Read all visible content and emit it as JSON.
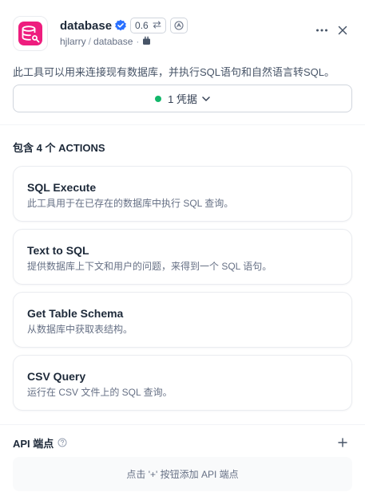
{
  "header": {
    "app_name": "database",
    "version": "0.6",
    "version_prefix": "0.",
    "author": "hjlarry",
    "path_sep": "/",
    "repo": "database",
    "meta_dot": "·"
  },
  "description": "此工具可以用来连接现有数据库，并执行SQL语句和自然语言转SQL。",
  "credentials": {
    "label": "1 凭据"
  },
  "actions_section": {
    "title": "包含 4 个 ACTIONS",
    "items": [
      {
        "name": "SQL Execute",
        "desc": "此工具用于在已存在的数据库中执行 SQL 查询。"
      },
      {
        "name": "Text to SQL",
        "desc": "提供数据库上下文和用户的问题，来得到一个 SQL 语句。"
      },
      {
        "name": "Get Table Schema",
        "desc": "从数据库中获取表结构。"
      },
      {
        "name": "CSV Query",
        "desc": "运行在 CSV 文件上的 SQL 查询。"
      }
    ]
  },
  "api_section": {
    "title": "API 端点",
    "empty_text": "点击 '+' 按钮添加 API 端点"
  },
  "colors": {
    "brand": "#ee1d7e",
    "verified": "#2970ff",
    "status_ok": "#12b76a"
  },
  "icons": {
    "logo": "database-icon",
    "verified": "verified-badge-icon",
    "swap": "swap-icon",
    "plugin": "plugin-icon",
    "more": "more-dots-icon",
    "close": "close-icon",
    "chevron": "chevron-down-icon",
    "help": "help-icon",
    "add": "plus-icon"
  }
}
